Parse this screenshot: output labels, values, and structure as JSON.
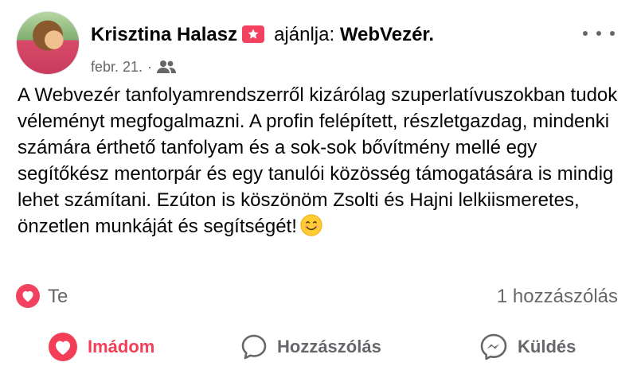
{
  "post": {
    "author": "Krisztina Halasz",
    "verb": "ajánlja:",
    "page_name": "WebVezér.",
    "date": "febr. 21.",
    "separator": "·",
    "audience_icon": "friends-icon",
    "text": "A Webvezér tanfolyamrendszerről kizárólag szuperlatívuszokban tudok véleményt megfogalmazni. A profin felépített, részletgazdag, mindenki számára érthető tanfolyam és a sok-sok bővítmény mellé egy segítőkész mentorpár és egy tanulói közösség támogatására is mindig lehet számítani. Ezúton is köszönöm Zsolti és Hajni lelkiismeretes, önzetlen munkáját és segítségét!",
    "emoji": "smiling-face"
  },
  "stats": {
    "reaction_icon": "heart-icon",
    "reaction_by": "Te",
    "comment_count": "1 hozzászólás"
  },
  "actions": {
    "love": "Imádom",
    "comment": "Hozzászólás",
    "send": "Küldés"
  },
  "colors": {
    "love_accent": "#f33e58",
    "muted": "#65676b",
    "text": "#050505"
  }
}
